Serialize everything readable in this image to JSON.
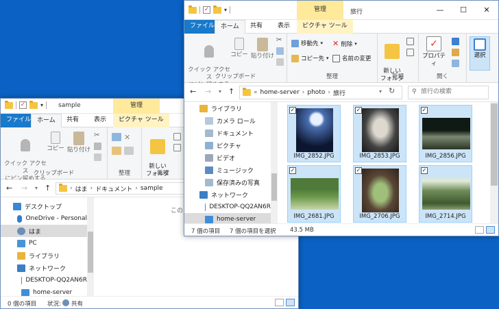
{
  "winA": {
    "path_label": "sample",
    "mgmt_tab": "管理",
    "tabs": [
      "ファイル",
      "ホーム",
      "共有",
      "表示",
      "ピクチャ ツール"
    ],
    "ribbon": {
      "quick_access": "クイック アクセス\nにピン留めする",
      "copy": "コピー",
      "paste": "貼り付け",
      "clipboard_label": "クリップボード",
      "organize_label": "整理",
      "new_folder": "新しい\nフォルダー",
      "new_label": "新規"
    },
    "breadcrumb": [
      "はま",
      "ドキュメント",
      "sample"
    ],
    "nav": [
      "デスクトップ",
      "OneDrive - Personal",
      "はま",
      "PC",
      "ライブラリ",
      "ネットワーク",
      "DESKTOP-QQ2AN6R",
      "home-server"
    ],
    "content_text": "このフ",
    "status": {
      "count": "0 個の項目",
      "state_label": "状況:",
      "shared": "共有"
    }
  },
  "winB": {
    "mgmt_tab": "管理",
    "title": "旅行",
    "tabs": [
      "ファイル",
      "ホーム",
      "共有",
      "表示",
      "ピクチャ ツール"
    ],
    "ribbon": {
      "quick_access": "クイック アクセス\nにピン留めする",
      "copy": "コピー",
      "paste": "貼り付け",
      "clipboard_label": "クリップボード",
      "move_to": "移動先",
      "copy_to": "コピー先",
      "delete": "削除",
      "rename": "名前の変更",
      "organize_label": "整理",
      "new_folder": "新しい\nフォルダー",
      "new_label": "新規",
      "properties": "プロパティ",
      "open_label": "開く",
      "select": "選択"
    },
    "breadcrumb": [
      "home-server",
      "photo",
      "旅行"
    ],
    "search_placeholder": "旅行の検索",
    "nav": [
      "ライブラリ",
      "カメラ ロール",
      "ドキュメント",
      "ピクチャ",
      "ビデオ",
      "ミュージック",
      "保存済みの写真",
      "ネットワーク",
      "DESKTOP-QQ2AN6R",
      "home-server"
    ],
    "files": [
      "IMG_2852.JPG",
      "IMG_2853.JPG",
      "IMG_2856.JPG",
      "IMG_2681.JPG",
      "IMG_2706.JPG",
      "IMG_2714.JPG"
    ],
    "status": {
      "count": "7 個の項目",
      "selected": "7 個の項目を選択",
      "size": "43.5 MB"
    }
  },
  "window_controls": {
    "minimize": "—",
    "maximize": "☐",
    "close": "✕"
  },
  "colors": {
    "desktop": "#0b62c4",
    "file_tab": "#1979ca",
    "selection": "#cce4f7",
    "mgmt_tab": "#ffe99a"
  }
}
